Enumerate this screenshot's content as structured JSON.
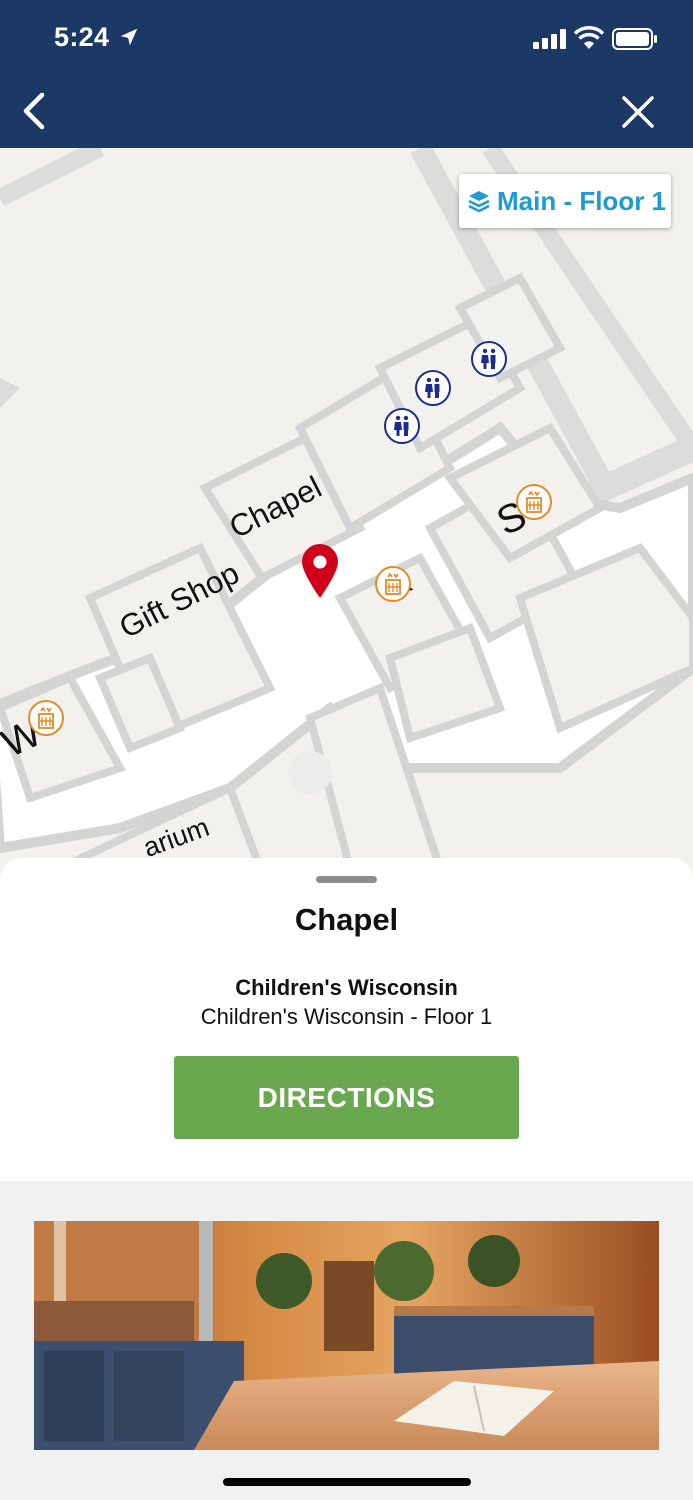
{
  "status_bar": {
    "time": "5:24"
  },
  "header": {
    "back_icon": "chevron-left-icon",
    "close_icon": "close-icon"
  },
  "map": {
    "floor_selector": {
      "icon": "layers-icon",
      "label": "Main - Floor 1"
    },
    "labels": {
      "chapel": "Chapel",
      "gift_shop": "Gift Shop",
      "partial_arium": "arium"
    },
    "pin_color": "#d0021b"
  },
  "sheet": {
    "title": "Chapel",
    "venue_name": "Children's Wisconsin",
    "venue_floor": "Children's Wisconsin - Floor 1",
    "directions_label": "DIRECTIONS",
    "button_color": "#6aa84f"
  },
  "colors": {
    "header_bg": "#1c3966",
    "floor_text": "#1e9ad7",
    "restroom": "#1d2b8f",
    "elevator": "#e58a26"
  }
}
